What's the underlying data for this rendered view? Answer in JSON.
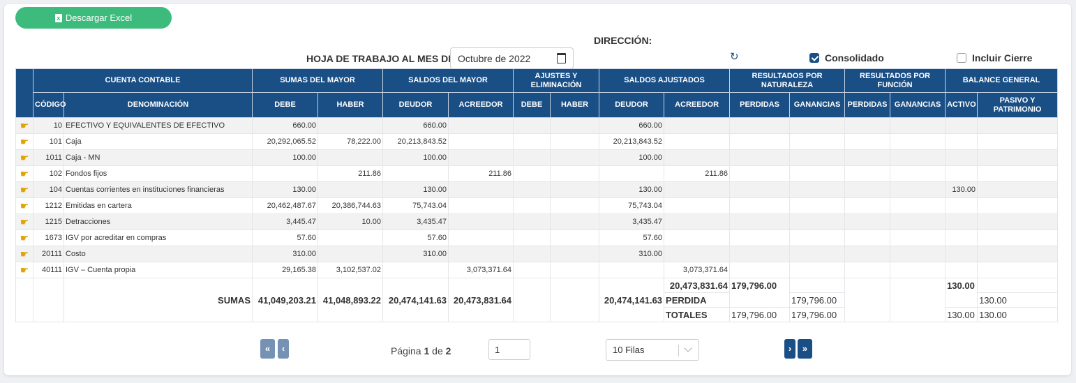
{
  "toolbar": {
    "excel_label": "Descargar Excel",
    "excel_icon": "file-excel-icon"
  },
  "header": {
    "direccion_label": "DIRECCIÓN:",
    "hoja_label": "HOJA DE TRABAJO AL MES DE",
    "date_value": "Octubre de 2022",
    "consolidado_label": "Consolidado",
    "consolidado_checked": true,
    "incluir_cierre_label": "Incluir Cierre",
    "incluir_cierre_checked": false
  },
  "table": {
    "group_headers": [
      "CUENTA CONTABLE",
      "SUMAS DEL MAYOR",
      "SALDOS DEL MAYOR",
      "AJUSTES Y ELIMINACIÓN",
      "SALDOS AJUSTADOS",
      "RESULTADOS POR NATURALEZA",
      "RESULTADOS POR FUNCIÓN",
      "BALANCE GENERAL"
    ],
    "sub_headers": [
      "CÓDIGO",
      "DENOMINACIÓN",
      "DEBE",
      "HABER",
      "DEUDOR",
      "ACREEDOR",
      "DEBE",
      "HABER",
      "DEUDOR",
      "ACREEDOR",
      "PERDIDAS",
      "GANANCIAS",
      "PERDIDAS",
      "GANANCIAS",
      "ACTIVO",
      "PASIVO Y PATRIMONIO"
    ],
    "rows": [
      [
        "10",
        "EFECTIVO Y EQUIVALENTES DE EFECTIVO",
        "660.00",
        "",
        "660.00",
        "",
        "",
        "",
        "660.00",
        "",
        "",
        "",
        "",
        "",
        "",
        ""
      ],
      [
        "101",
        "Caja",
        "20,292,065.52",
        "78,222.00",
        "20,213,843.52",
        "",
        "",
        "",
        "20,213,843.52",
        "",
        "",
        "",
        "",
        "",
        "",
        ""
      ],
      [
        "1011",
        "Caja - MN",
        "100.00",
        "",
        "100.00",
        "",
        "",
        "",
        "100.00",
        "",
        "",
        "",
        "",
        "",
        "",
        ""
      ],
      [
        "102",
        "Fondos fijos",
        "",
        "211.86",
        "",
        "211.86",
        "",
        "",
        "",
        "211.86",
        "",
        "",
        "",
        "",
        "",
        ""
      ],
      [
        "104",
        "Cuentas corrientes en instituciones financieras",
        "130.00",
        "",
        "130.00",
        "",
        "",
        "",
        "130.00",
        "",
        "",
        "",
        "",
        "",
        "130.00",
        ""
      ],
      [
        "1212",
        "Emitidas en cartera",
        "20,462,487.67",
        "20,386,744.63",
        "75,743.04",
        "",
        "",
        "",
        "75,743.04",
        "",
        "",
        "",
        "",
        "",
        "",
        ""
      ],
      [
        "1215",
        "Detracciones",
        "3,445.47",
        "10.00",
        "3,435.47",
        "",
        "",
        "",
        "3,435.47",
        "",
        "",
        "",
        "",
        "",
        "",
        ""
      ],
      [
        "1673",
        "IGV por acreditar en compras",
        "57.60",
        "",
        "57.60",
        "",
        "",
        "",
        "57.60",
        "",
        "",
        "",
        "",
        "",
        "",
        ""
      ],
      [
        "20111",
        "Costo",
        "310.00",
        "",
        "310.00",
        "",
        "",
        "",
        "310.00",
        "",
        "",
        "",
        "",
        "",
        "",
        ""
      ],
      [
        "40111",
        "IGV – Cuenta propia",
        "29,165.38",
        "3,102,537.02",
        "",
        "3,073,371.64",
        "",
        "",
        "",
        "3,073,371.64",
        "",
        "",
        "",
        "",
        "",
        ""
      ]
    ],
    "row_icon": "hand-pointer-icon",
    "totals": {
      "sumas_label": "SUMAS",
      "sumas_debe": "41,049,203.21",
      "sumas_haber": "41,048,893.22",
      "sumas_deudor": "20,474,141.63",
      "sumas_acreedor": "20,473,831.64",
      "sumas_aj_deudor": "20,474,141.63",
      "sumas_aj_acreedor": "20,473,831.64",
      "sumas_nat_perdidas": "179,796.00",
      "sumas_activo": "130.00",
      "perdida_label": "PERDIDA",
      "perdida_nat_ganancias": "179,796.00",
      "perdida_pasivo": "130.00",
      "totales_label": "TOTALES",
      "totales_nat_perdidas": "179,796.00",
      "totales_nat_ganancias": "179,796.00",
      "totales_activo": "130.00",
      "totales_pasivo": "130.00"
    }
  },
  "pagination": {
    "first_label": "«",
    "prev_label": "‹",
    "next_label": "›",
    "last_label": "»",
    "page_prefix": "Página",
    "current_page": "1",
    "of_label": "de",
    "total_pages": "2",
    "page_input_value": "1",
    "rows_select": "10 Filas"
  }
}
